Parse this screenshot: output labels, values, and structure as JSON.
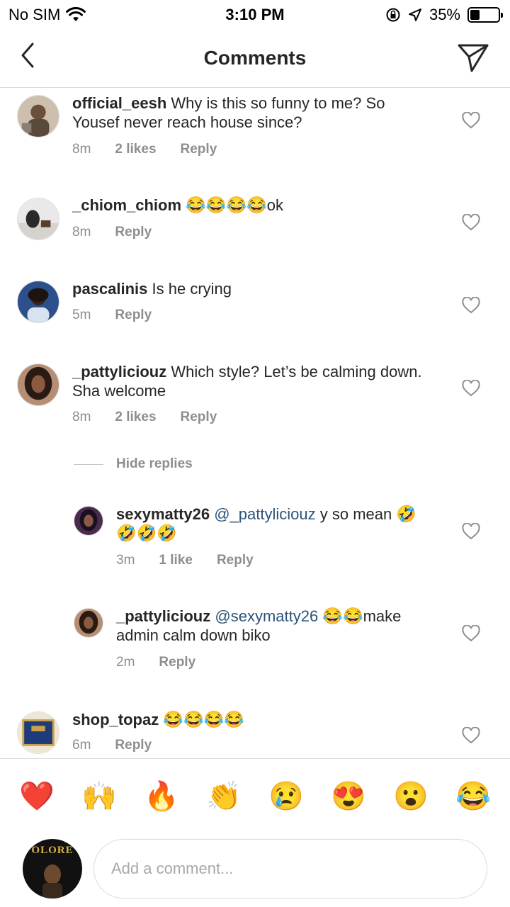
{
  "status_bar": {
    "carrier": "No SIM",
    "time": "3:10 PM",
    "battery": "35%",
    "battery_level": 0.35
  },
  "nav": {
    "title": "Comments"
  },
  "comments": [
    {
      "username": "official_eesh",
      "text": "Why is this so funny to me? So Yousef never reach house since?",
      "time": "8m",
      "likes": "2 likes",
      "reply": "Reply"
    },
    {
      "username": "_chiom_chiom",
      "emojis": "😂😂😂😂",
      "text": "ok",
      "time": "8m",
      "reply": "Reply"
    },
    {
      "username": "pascalinis",
      "text": "Is he crying",
      "time": "5m",
      "reply": "Reply"
    },
    {
      "username": "_pattyliciouz",
      "text": "Which style? Let’s be calming down. Sha welcome",
      "time": "8m",
      "likes": "2 likes",
      "reply": "Reply"
    },
    {
      "username": "sexymatty26",
      "mention": "@_pattyliciouz",
      "text": "y so mean",
      "emojis": "🤣🤣🤣🤣",
      "time": "3m",
      "likes": "1 like",
      "reply": "Reply"
    },
    {
      "username": "_pattyliciouz",
      "mention": "@sexymatty26",
      "emojis": "😂😂",
      "text": "make",
      "text2": "admin calm down biko",
      "time": "2m",
      "reply": "Reply"
    },
    {
      "username": "shop_topaz",
      "emojis": "😂😂😂😂",
      "time": "6m",
      "reply": "Reply"
    }
  ],
  "hide_replies": "Hide replies",
  "reactions": [
    "❤️",
    "🙌",
    "🔥",
    "👏",
    "😢",
    "😍",
    "😮",
    "😂"
  ],
  "composer": {
    "placeholder": "Add a comment...",
    "avatar_text": "OLORE"
  },
  "colors": {
    "mention": "#2b5478",
    "meta_gray": "#8e8e8e",
    "divider": "#dbdbdb"
  }
}
